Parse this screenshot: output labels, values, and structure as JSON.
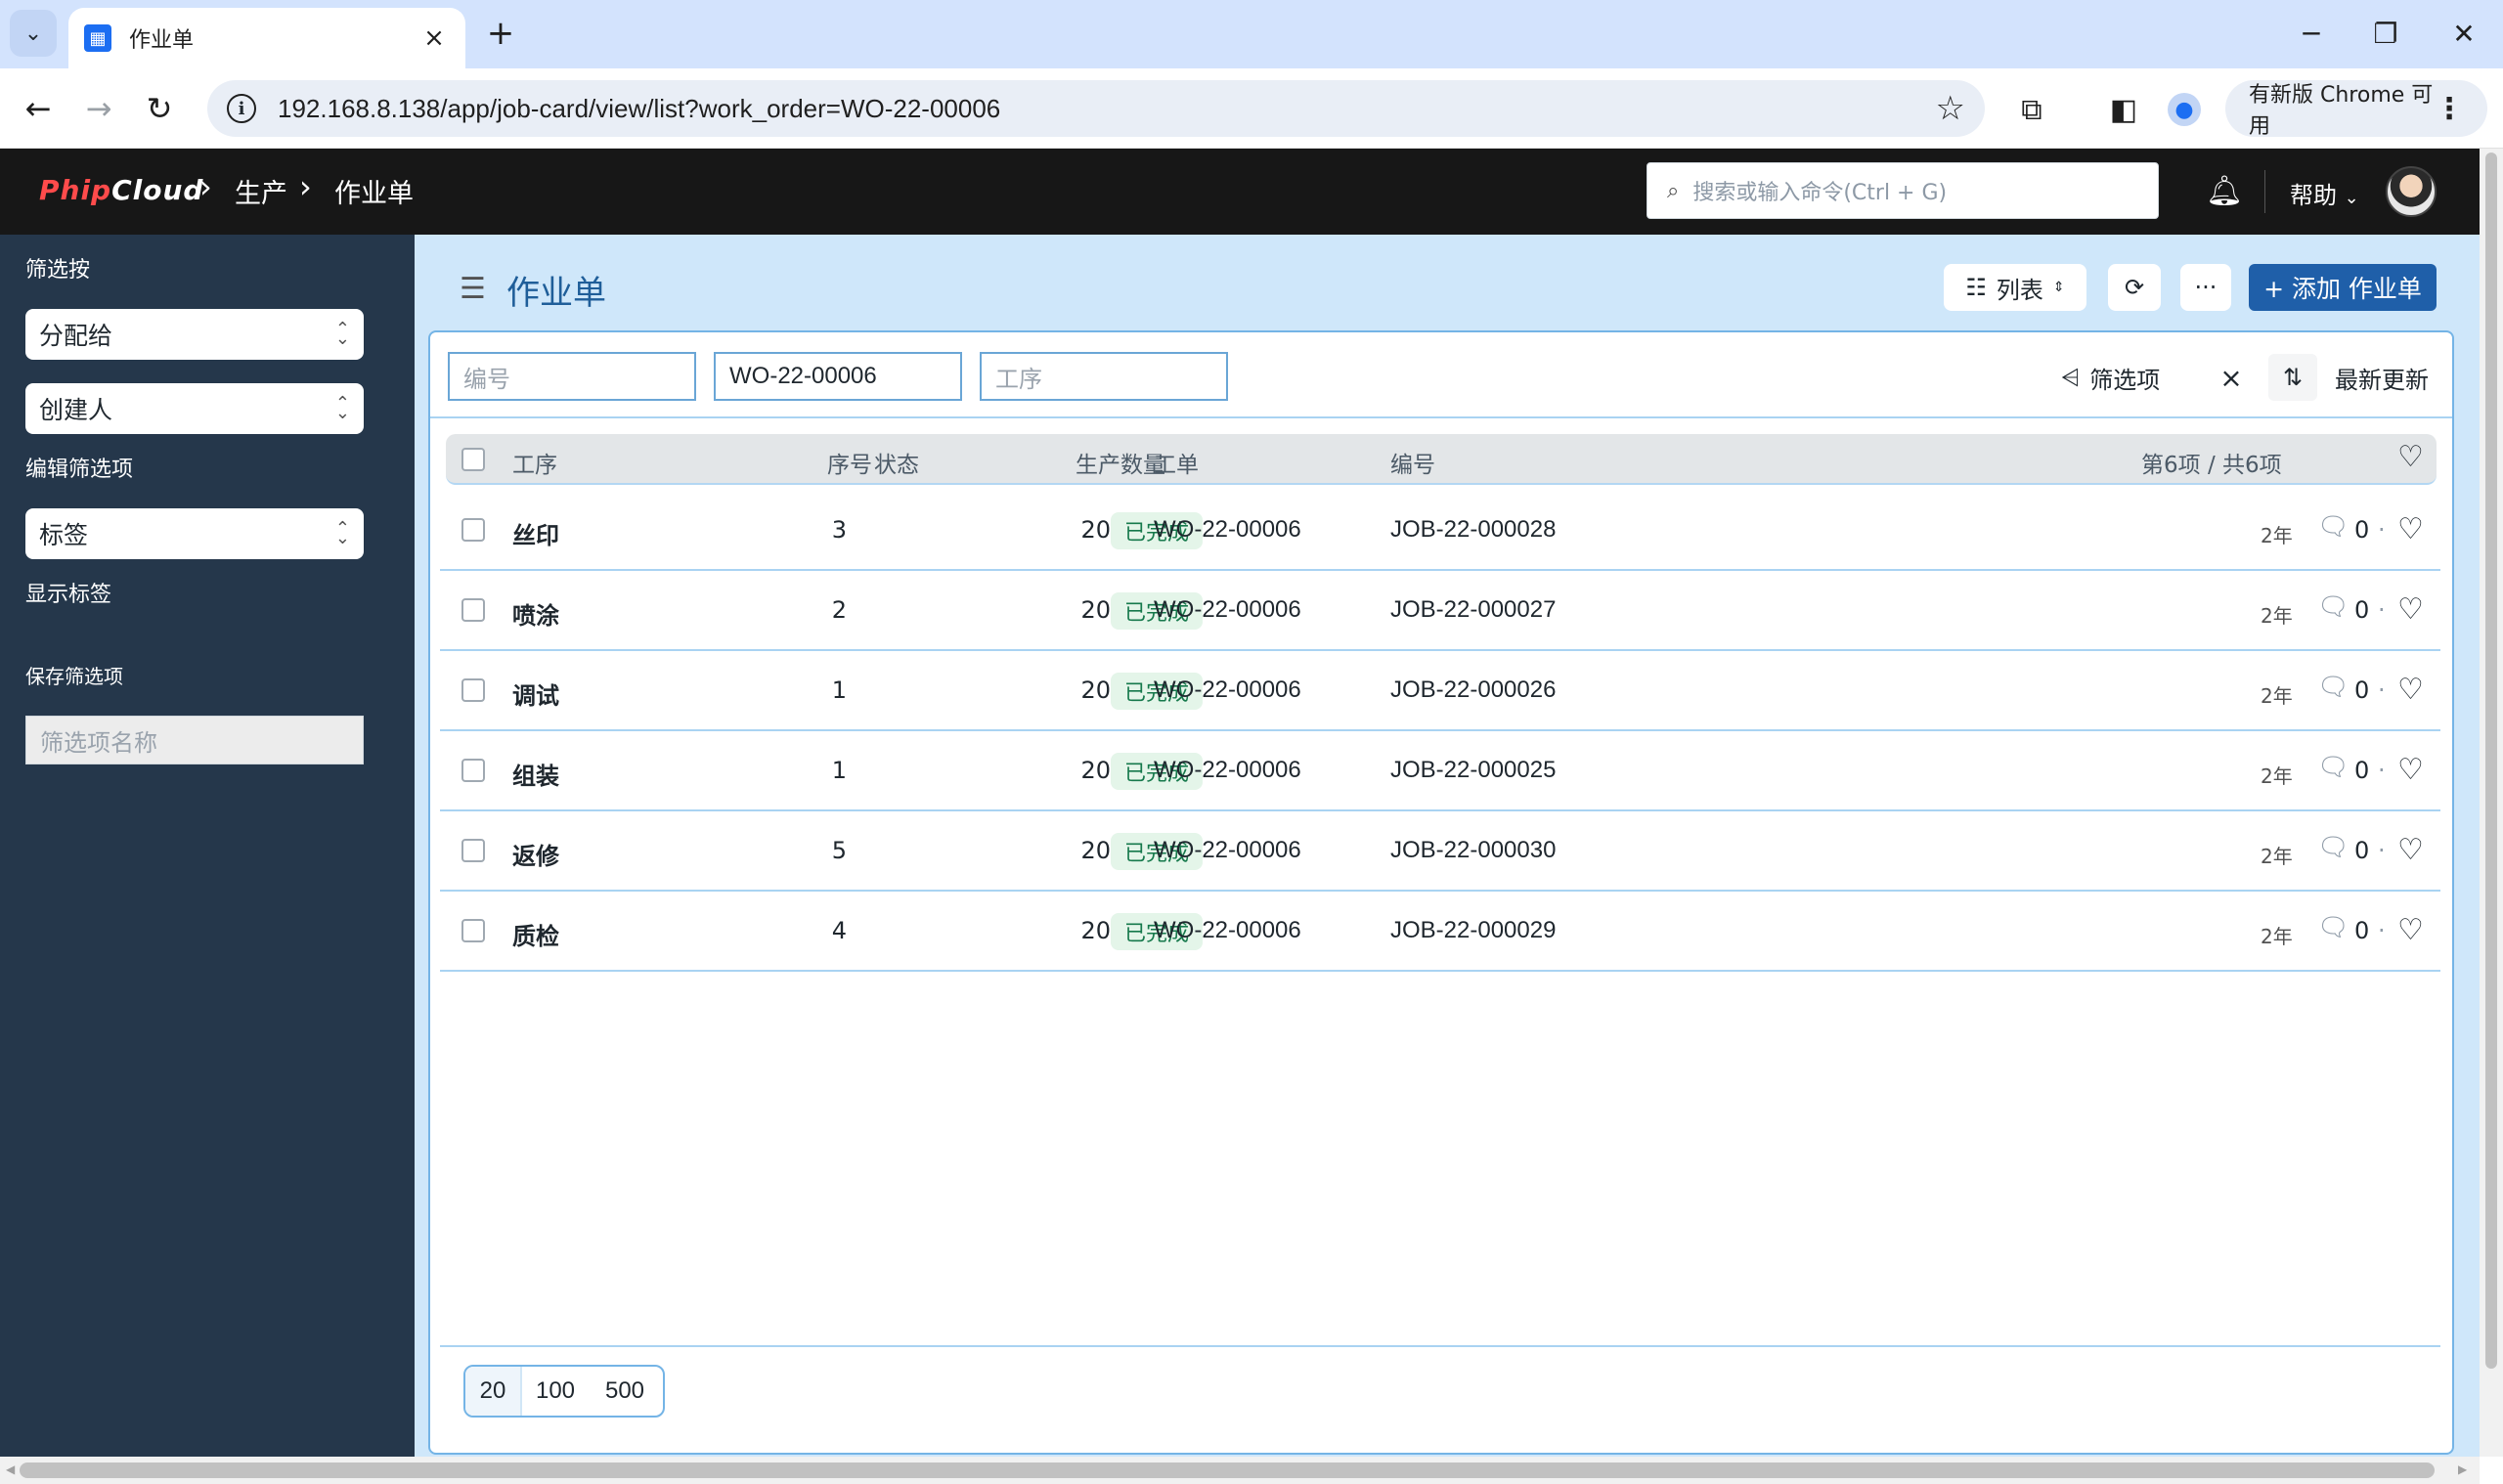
{
  "browser": {
    "tab_title": "作业单",
    "url": "192.168.8.138/app/job-card/view/list?work_order=WO-22-00006",
    "update_label": "有新版 Chrome 可用"
  },
  "navbar": {
    "logo_part1": "Phip",
    "logo_part2": "Cloud",
    "breadcrumb": [
      "生产",
      "作业单"
    ],
    "search_placeholder": "搜索或输入命令(Ctrl + G)",
    "help_label": "帮助"
  },
  "sidebar": {
    "filter_by": "筛选按",
    "select_assigned": "分配给",
    "select_creator": "创建人",
    "edit_filters": "编辑筛选项",
    "select_tags": "标签",
    "show_tags": "显示标签",
    "save_filters": "保存筛选项",
    "filter_name_placeholder": "筛选项名称"
  },
  "page": {
    "title": "作业单",
    "view_label": "列表",
    "more_label": "···",
    "add_label": "+ 添加 作业单"
  },
  "filters": {
    "name_placeholder": "编号",
    "work_order_value": "WO-22-00006",
    "operation_placeholder": "工序",
    "filter_label": "筛选项",
    "clear_label": "×",
    "sort_label": "最新更新"
  },
  "list": {
    "columns": {
      "operation": "工序",
      "seq": "序号",
      "status": "状态",
      "qty": "生产数量",
      "work_order": "工单",
      "name": "编号",
      "count": "第6项 / 共6项"
    },
    "rows": [
      {
        "operation": "丝印",
        "seq": "3",
        "status": "已完成",
        "qty": "20",
        "work_order": "WO-22-00006",
        "name": "JOB-22-000028",
        "time": "2年",
        "comments": "0"
      },
      {
        "operation": "喷涂",
        "seq": "2",
        "status": "已完成",
        "qty": "20",
        "work_order": "WO-22-00006",
        "name": "JOB-22-000027",
        "time": "2年",
        "comments": "0"
      },
      {
        "operation": "调试",
        "seq": "1",
        "status": "已完成",
        "qty": "20",
        "work_order": "WO-22-00006",
        "name": "JOB-22-000026",
        "time": "2年",
        "comments": "0"
      },
      {
        "operation": "组装",
        "seq": "1",
        "status": "已完成",
        "qty": "20",
        "work_order": "WO-22-00006",
        "name": "JOB-22-000025",
        "time": "2年",
        "comments": "0"
      },
      {
        "operation": "返修",
        "seq": "5",
        "status": "已完成",
        "qty": "20",
        "work_order": "WO-22-00006",
        "name": "JOB-22-000030",
        "time": "2年",
        "comments": "0"
      },
      {
        "operation": "质检",
        "seq": "4",
        "status": "已完成",
        "qty": "20",
        "work_order": "WO-22-00006",
        "name": "JOB-22-000029",
        "time": "2年",
        "comments": "0"
      }
    ]
  },
  "paging": [
    "20",
    "100",
    "500"
  ],
  "colors": {
    "navbar_bg": "#171717",
    "sidebar_bg": "#25374b",
    "primary": "#1f5fa9",
    "status_green": "#16794c"
  }
}
